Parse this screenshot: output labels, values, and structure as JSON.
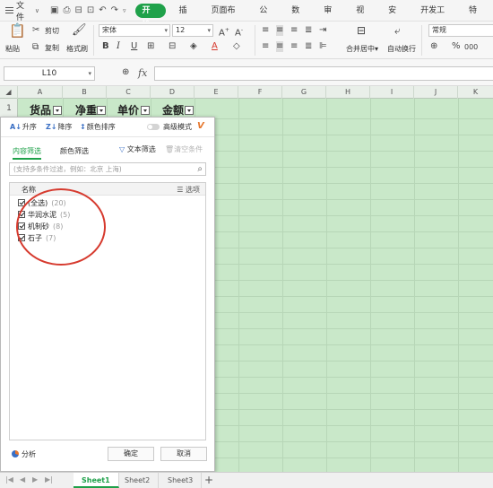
{
  "menu": {
    "file_label": "文件",
    "tabs": [
      "开始",
      "插入",
      "页面布局",
      "公式",
      "数据",
      "审阅",
      "视图",
      "安全",
      "开发工具",
      "特色"
    ],
    "active_tab": "开始"
  },
  "ribbon": {
    "paste": "粘贴",
    "cut": "剪切",
    "copy": "复制",
    "format_painter": "格式刷",
    "font_name": "宋体",
    "font_size": "12",
    "merge_center": "合并居中",
    "wrap_text": "自动换行",
    "number_format": "常规",
    "percent": "%",
    "comma": "000"
  },
  "formula_bar": {
    "name_box": "L10",
    "fx": "fx",
    "value": ""
  },
  "grid": {
    "columns": [
      "A",
      "B",
      "C",
      "D",
      "E",
      "F",
      "G",
      "H",
      "I",
      "J",
      "K"
    ],
    "row1_number": "1",
    "headers": [
      "货品",
      "净重",
      "单价",
      "金额"
    ]
  },
  "filter_panel": {
    "sort_asc": "升序",
    "sort_desc": "降序",
    "color_sort": "颜色排序",
    "advanced_mode": "高级模式",
    "tab_content": "内容筛选",
    "tab_color": "颜色筛选",
    "text_filter": "文本筛选",
    "clear_condition": "清空条件",
    "search_placeholder": "(支持多条件过滤，例如：北京 上海)",
    "list_header_name": "名称",
    "list_header_options": "选项",
    "items": [
      {
        "label": "(全选)",
        "count": "(20)",
        "checked": true
      },
      {
        "label": "华润水泥",
        "count": "(5)",
        "checked": true
      },
      {
        "label": "机制砂",
        "count": "(8)",
        "checked": true
      },
      {
        "label": "石子",
        "count": "(7)",
        "checked": true
      }
    ],
    "analyze": "分析",
    "ok": "确定",
    "cancel": "取消"
  },
  "sheets": {
    "tabs": [
      "Sheet1",
      "Sheet2",
      "Sheet3"
    ],
    "active": "Sheet1",
    "add": "+"
  },
  "colors": {
    "accent": "#1fa14a",
    "grid_bg": "#c9e8c9",
    "highlight_circle": "#d63a2e"
  }
}
